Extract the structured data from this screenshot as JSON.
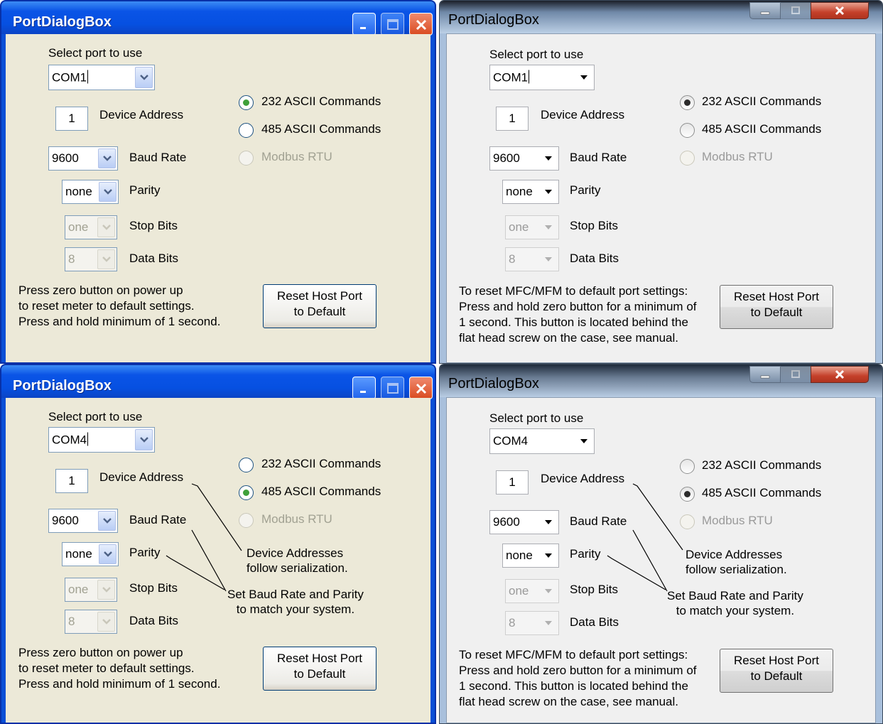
{
  "windows": {
    "top_left": {
      "title": "PortDialogBox",
      "select_port_label": "Select port to use",
      "port_value": "COM1",
      "device_address_value": "1",
      "device_address_label": "Device Address",
      "baud_value": "9600",
      "baud_label": "Baud Rate",
      "parity_value": "none",
      "parity_label": "Parity",
      "stop_value": "one",
      "stop_label": "Stop Bits",
      "data_value": "8",
      "data_label": "Data Bits",
      "radio_232": "232 ASCII Commands",
      "radio_485": "485 ASCII Commands",
      "radio_modbus": "Modbus RTU",
      "selected_protocol": "232 ASCII Commands",
      "note": [
        "Press zero button on power up",
        "to reset meter to default settings.",
        "Press and hold minimum of 1 second."
      ],
      "reset_button": [
        "Reset Host Port",
        "to Default"
      ]
    },
    "top_right": {
      "title": "PortDialogBox",
      "select_port_label": "Select port to use",
      "port_value": "COM1",
      "device_address_value": "1",
      "device_address_label": "Device Address",
      "baud_value": "9600",
      "baud_label": "Baud Rate",
      "parity_value": "none",
      "parity_label": "Parity",
      "stop_value": "one",
      "stop_label": "Stop Bits",
      "data_value": "8",
      "data_label": "Data Bits",
      "radio_232": "232 ASCII Commands",
      "radio_485": "485 ASCII Commands",
      "radio_modbus": "Modbus RTU",
      "selected_protocol": "232 ASCII Commands",
      "note": [
        "To reset MFC/MFM to default port settings:",
        "Press and hold zero button for a minimum of",
        "1 second. This button is located behind the",
        "flat head screw on the case, see manual."
      ],
      "reset_button": [
        "Reset Host Port",
        "to Default"
      ]
    },
    "bottom_left": {
      "title": "PortDialogBox",
      "select_port_label": "Select port to use",
      "port_value": "COM4",
      "device_address_value": "1",
      "device_address_label": "Device Address",
      "baud_value": "9600",
      "baud_label": "Baud Rate",
      "parity_value": "none",
      "parity_label": "Parity",
      "stop_value": "one",
      "stop_label": "Stop Bits",
      "data_value": "8",
      "data_label": "Data Bits",
      "radio_232": "232 ASCII Commands",
      "radio_485": "485 ASCII Commands",
      "radio_modbus": "Modbus RTU",
      "selected_protocol": "485 ASCII Commands",
      "note": [
        "Press zero button on power up",
        "to reset meter to default settings.",
        "Press and hold minimum of 1 second."
      ],
      "reset_button": [
        "Reset Host Port",
        "to Default"
      ],
      "annotation_device": [
        "Device Addresses",
        "follow serialization."
      ],
      "annotation_baud": [
        "Set Baud Rate and Parity",
        "to match your system."
      ]
    },
    "bottom_right": {
      "title": "PortDialogBox",
      "select_port_label": "Select port to use",
      "port_value": "COM4",
      "device_address_value": "1",
      "device_address_label": "Device Address",
      "baud_value": "9600",
      "baud_label": "Baud Rate",
      "parity_value": "none",
      "parity_label": "Parity",
      "stop_value": "one",
      "stop_label": "Stop Bits",
      "data_value": "8",
      "data_label": "Data Bits",
      "radio_232": "232 ASCII Commands",
      "radio_485": "485 ASCII Commands",
      "radio_modbus": "Modbus RTU",
      "selected_protocol": "485 ASCII Commands",
      "note": [
        "To reset MFC/MFM to default port settings:",
        "Press and hold zero button for a minimum of",
        "1 second. This button is located behind the",
        "flat head screw on the case, see manual."
      ],
      "reset_button": [
        "Reset Host Port",
        "to Default"
      ],
      "annotation_device": [
        "Device Addresses",
        "follow serialization."
      ],
      "annotation_baud": [
        "Set Baud Rate and Parity",
        "to match your system."
      ]
    }
  }
}
